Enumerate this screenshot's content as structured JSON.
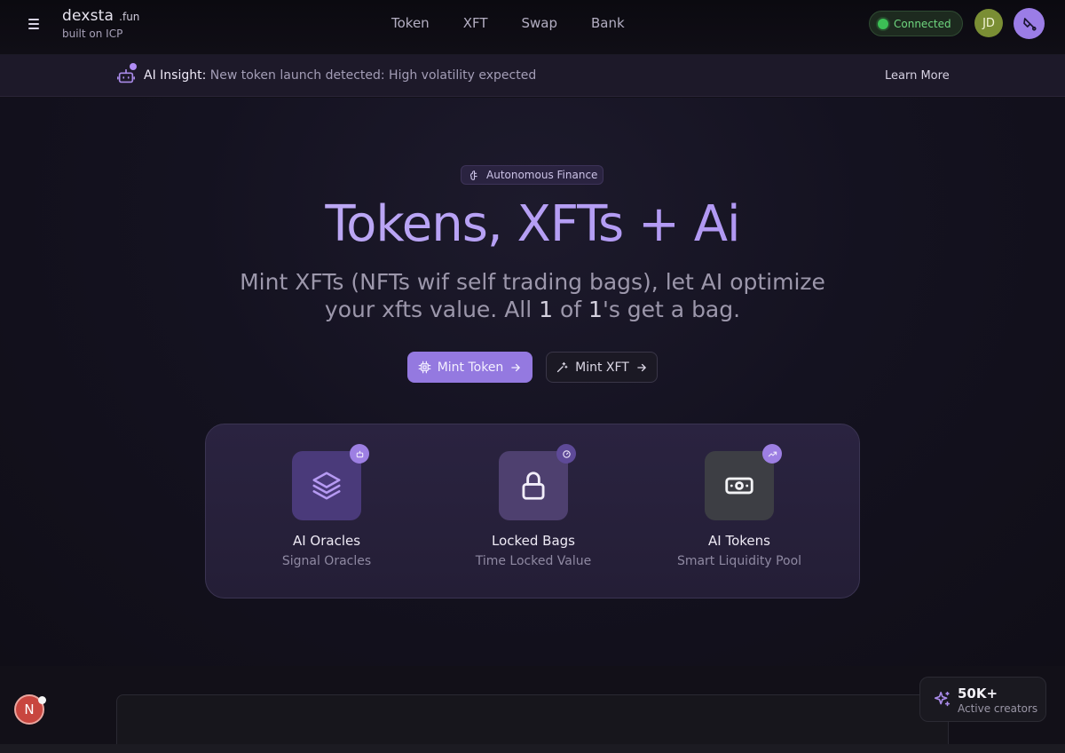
{
  "brand": {
    "name": "dexsta",
    "tld": ".fun",
    "subtitle": "built on ICP"
  },
  "nav": [
    "Token",
    "XFT",
    "Swap",
    "Bank"
  ],
  "header": {
    "status": "Connected",
    "avatar_initials": "JD"
  },
  "insight": {
    "label": "AI Insight:",
    "message": "New token launch detected: High volatility expected",
    "action": "Learn More"
  },
  "hero": {
    "badge": "Autonomous Finance",
    "title": "Tokens, XFTs + Ai",
    "subtitle_part1": "Mint XFTs (NFTs wif self trading bags), let AI optimize your xfts value. All ",
    "subtitle_one_a": "1",
    "subtitle_of": " of ",
    "subtitle_one_b": "1",
    "subtitle_part2": "'s get a bag.",
    "primary_button": "Mint Token",
    "secondary_button": "Mint XFT"
  },
  "features": [
    {
      "title": "AI Oracles",
      "subtitle": "Signal Oracles",
      "icon": "layers-icon"
    },
    {
      "title": "Locked Bags",
      "subtitle": "Time Locked Value",
      "icon": "lock-icon"
    },
    {
      "title": "AI Tokens",
      "subtitle": "Smart Liquidity Pool",
      "icon": "cash-icon"
    }
  ],
  "lower_panel": {
    "heading": ""
  },
  "notification": {
    "initial": "N"
  },
  "stats": {
    "value": "50K+",
    "label": "Active creators"
  },
  "colors": {
    "accent": "#9479e0",
    "success": "#3cbf55",
    "background": "#121018"
  }
}
